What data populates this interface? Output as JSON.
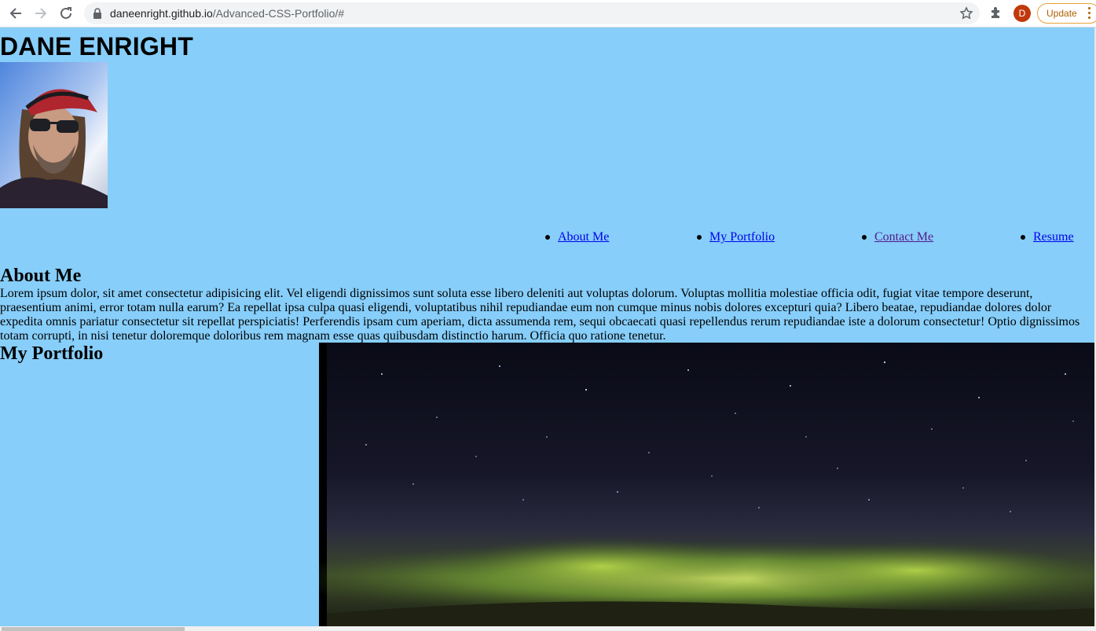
{
  "browser": {
    "url_host": "daneenright.github.io",
    "url_path": "/Advanced-CSS-Portfolio/#",
    "profile_initial": "D",
    "update_label": "Update"
  },
  "header": {
    "title": "DANE ENRIGHT"
  },
  "nav": {
    "items": [
      {
        "label": "About Me"
      },
      {
        "label": "My Portfolio"
      },
      {
        "label": "Contact Me"
      },
      {
        "label": "Resume"
      }
    ]
  },
  "about": {
    "heading": "About Me",
    "text": "Lorem ipsum dolor, sit amet consectetur adipisicing elit. Vel eligendi dignissimos sunt soluta esse libero deleniti aut voluptas dolorum. Voluptas mollitia molestiae officia odit, fugiat vitae tempore deserunt, praesentium animi, error totam nulla earum? Ea repellat ipsa culpa quasi eligendi, voluptatibus nihil repudiandae eum non cumque minus nobis dolores excepturi quia? Libero beatae, repudiandae dolores dolor expedita omnis pariatur consectetur sit repellat perspiciatis! Perferendis ipsam cum aperiam, dicta assumenda rem, sequi obcaecati quasi repellendus rerum repudiandae iste a dolorum consectetur! Optio dignissimos totam corrupti, in nisi tenetur doloremque doloribus rem magnam esse quas quibusdam distinctio harum. Officia quo ratione tenetur."
  },
  "portfolio": {
    "heading": "My Portfolio"
  },
  "colors": {
    "page_background": "#87cefa",
    "link": "#0000ee",
    "link_visited": "#551a8b"
  }
}
